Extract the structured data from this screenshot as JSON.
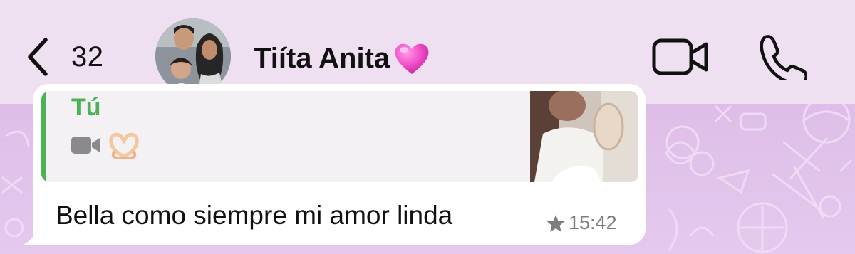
{
  "header": {
    "back_count": "32",
    "contact_name": "Tiíta Anita",
    "contact_emoji": "pink-heart-emoji"
  },
  "message": {
    "quoted": {
      "author": "Tú",
      "media_type": "video-icon",
      "media_emoji": "heart-hands-emoji"
    },
    "text": "Bella como siempre mi amor linda",
    "starred": true,
    "time": "15:42"
  },
  "colors": {
    "header_bg": "#efe0f1",
    "wallpaper": "#e2c5ea",
    "quote_accent": "#4db158",
    "bubble_bg": "#ffffff"
  }
}
